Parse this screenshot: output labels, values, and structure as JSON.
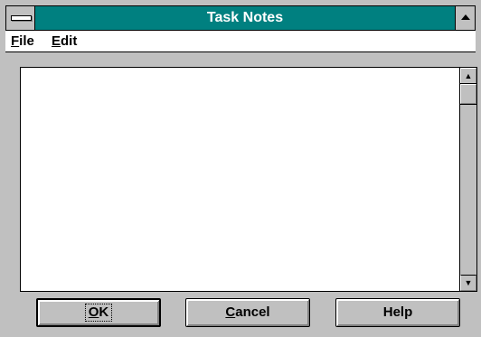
{
  "window": {
    "title": "Task Notes",
    "title_bar_color": "#008080",
    "system_menu_icon": "system-menu-icon",
    "maximize_icon": "maximize-icon"
  },
  "menu": {
    "items": [
      {
        "label": "File",
        "accel": "F",
        "rest": "ile"
      },
      {
        "label": "Edit",
        "accel": "E",
        "rest": "dit"
      }
    ]
  },
  "editor": {
    "content": ""
  },
  "scrollbar": {
    "up_icon": "up-arrow-icon",
    "down_icon": "down-arrow-icon",
    "position": 0
  },
  "buttons": {
    "ok": {
      "label": "OK",
      "accel": "O",
      "rest": "K"
    },
    "cancel": {
      "label": "Cancel",
      "accel": "C",
      "rest": "ancel"
    },
    "help": {
      "label": "Help"
    }
  }
}
